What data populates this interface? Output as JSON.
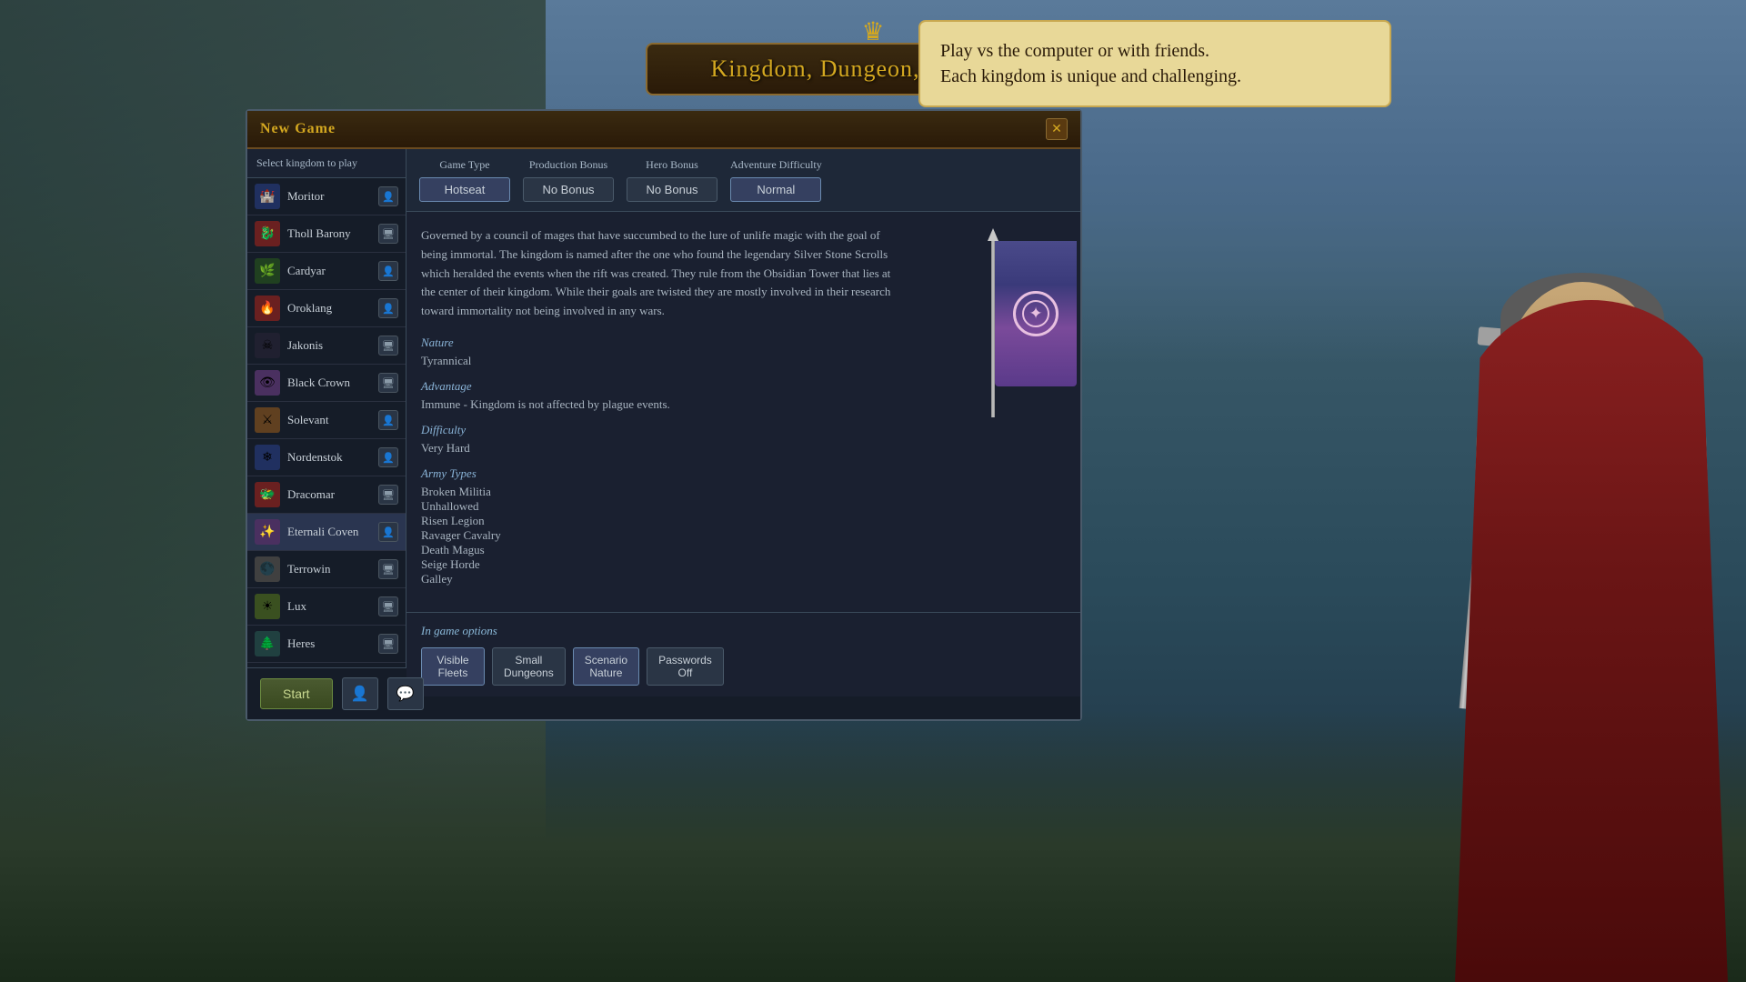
{
  "background": {
    "color": "#2a3a4a"
  },
  "title_banner": {
    "text": "Kingdom, Dungeon, and Magic",
    "crown": "♛"
  },
  "tooltip": {
    "line1": "Play vs the computer or with friends.",
    "line2": "Each kingdom is unique and challenging."
  },
  "dialog": {
    "title": "New Game",
    "close_label": "✕",
    "select_kingdom_label": "Select kingdom to play",
    "kingdoms": [
      {
        "name": "Moritor",
        "icon": "🏰",
        "color": "ki-blue",
        "type": "person"
      },
      {
        "name": "Tholl Barony",
        "icon": "🐉",
        "color": "ki-red",
        "type": "screen"
      },
      {
        "name": "Cardyar",
        "icon": "🌿",
        "color": "ki-green",
        "type": "person"
      },
      {
        "name": "Oroklang",
        "icon": "🔥",
        "color": "ki-red",
        "type": "person"
      },
      {
        "name": "Jakonis",
        "icon": "☠",
        "color": "ki-dark",
        "type": "screen"
      },
      {
        "name": "Black Crown",
        "icon": "👁",
        "color": "ki-purple",
        "type": "screen"
      },
      {
        "name": "Solevant",
        "icon": "⚔",
        "color": "ki-gold",
        "type": "person"
      },
      {
        "name": "Nordenstok",
        "icon": "❄",
        "color": "ki-blue",
        "type": "person"
      },
      {
        "name": "Dracomar",
        "icon": "🐲",
        "color": "ki-red",
        "type": "screen"
      },
      {
        "name": "Eternali Coven",
        "icon": "✨",
        "color": "ki-purple",
        "type": "person",
        "selected": true
      },
      {
        "name": "Terrowin",
        "icon": "🌑",
        "color": "ki-gray",
        "type": "screen"
      },
      {
        "name": "Lux",
        "icon": "☀",
        "color": "ki-lime",
        "type": "screen"
      },
      {
        "name": "Heres",
        "icon": "🌲",
        "color": "ki-teal",
        "type": "screen"
      }
    ],
    "options": {
      "game_type_label": "Game Type",
      "game_type_value": "Hotseat",
      "production_bonus_label": "Production Bonus",
      "production_bonus_value": "No Bonus",
      "hero_bonus_label": "Hero Bonus",
      "hero_bonus_value": "No Bonus",
      "adventure_difficulty_label": "Adventure Difficulty",
      "adventure_difficulty_value": "Normal"
    },
    "description": {
      "text": "Governed by a council of mages that have succumbed to the lure of unlife magic with the goal of being immortal. The kingdom is named after the one who found the legendary Silver Stone Scrolls which heralded the events when the rift was created. They rule from the Obsidian Tower that lies at the center of their kingdom. While their goals are twisted they are mostly involved in their research toward immortality not being involved in any wars.",
      "nature_label": "Nature",
      "nature_value": "Tyrannical",
      "advantage_label": "Advantage",
      "advantage_value": "Immune - Kingdom is not affected by plague events.",
      "difficulty_label": "Difficulty",
      "difficulty_value": "Very Hard",
      "army_types_label": "Army Types",
      "army_types": [
        "Broken Militia",
        "Unhallowed",
        "Risen Legion",
        "Ravager Cavalry",
        "Death Magus",
        "Seige Horde",
        "Galley"
      ]
    },
    "ingame_options": {
      "title": "In game options",
      "buttons": [
        {
          "label": "Visible\nFleets",
          "active": true
        },
        {
          "label": "Small\nDungeons",
          "active": false
        },
        {
          "label": "Scenario\nNature",
          "active": true
        },
        {
          "label": "Passwords\nOff",
          "active": false
        }
      ]
    },
    "footer": {
      "start_label": "Start",
      "icon1": "👤",
      "icon2": "💬"
    }
  }
}
